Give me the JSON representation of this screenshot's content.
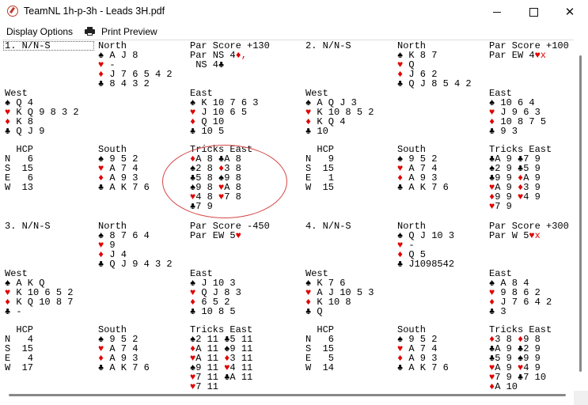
{
  "window": {
    "title": "TeamNL 1h-p-3h - Leads 3H.pdf",
    "minimize_glyph": "—",
    "maximize_glyph": "☐",
    "close_glyph": "✕"
  },
  "menu": {
    "display_options": "Display Options",
    "print_preview": "Print Preview"
  },
  "boards": [
    {
      "header": "1. N/N-S",
      "north": {
        "heading": "North",
        "spades": "A J 8",
        "hearts": "-",
        "diamonds": "J 7 6 5 4 2",
        "clubs": "8 4 3 2"
      },
      "par": [
        "Par Score +130",
        "Par NS 4",
        "♦,",
        " NS 4♣"
      ],
      "west": {
        "heading": "West",
        "spades": "Q 4",
        "hearts": "K Q 9 8 3 2",
        "diamonds": "K 8",
        "clubs": "Q J 9"
      },
      "east": {
        "heading": "East",
        "spades": "K 10 7 6 3",
        "hearts": "J 10 6 5",
        "diamonds": "Q 10",
        "clubs": "10 5"
      },
      "hcp": {
        "heading": "HCP",
        "rows": [
          "N   6",
          "S  15",
          "E   6",
          "W  13"
        ]
      },
      "south": {
        "heading": "South",
        "spades": "9 5 2",
        "hearts": "A 7 4",
        "diamonds": "A 9 3",
        "clubs": "A K 7 6"
      },
      "tricks": {
        "heading": "Tricks East",
        "rows": [
          [
            "♦",
            "A 8 ",
            "♣",
            "A 8"
          ],
          [
            "♠",
            "2 8 ",
            "♦",
            "3 8"
          ],
          [
            "♣",
            "5 8 ",
            "♠",
            "9 8"
          ],
          [
            "♠",
            "9 8 ",
            "♥",
            "A 8"
          ],
          [
            "♥",
            "4 8 ",
            "♥",
            "7 8"
          ],
          [
            "♣",
            "7 9 ",
            "",
            ""
          ]
        ]
      }
    },
    {
      "header": "2. N/N-S",
      "north": {
        "heading": "North",
        "spades": "K 8 7",
        "hearts": "Q",
        "diamonds": "J 6 2",
        "clubs": "Q J 8 5 4 2"
      },
      "par": [
        "Par Score +100",
        "Par EW 4",
        "♥x",
        ""
      ],
      "west": {
        "heading": "West",
        "spades": "A Q J 3",
        "hearts": "K 10 8 5 2",
        "diamonds": "K Q 4",
        "clubs": "10"
      },
      "east": {
        "heading": "East",
        "spades": "10 6 4",
        "hearts": "J 9 6 3",
        "diamonds": "10 8 7 5",
        "clubs": "9 3"
      },
      "hcp": {
        "heading": "HCP",
        "rows": [
          "N   9",
          "S  15",
          "E   1",
          "W  15"
        ]
      },
      "south": {
        "heading": "South",
        "spades": "9 5 2",
        "hearts": "A 7 4",
        "diamonds": "A 9 3",
        "clubs": "A K 7 6"
      },
      "tricks": {
        "heading": "Tricks East",
        "rows": [
          [
            "♣",
            "A 9 ",
            "♣",
            "7 9"
          ],
          [
            "♠",
            "2 9 ",
            "♣",
            "5 9"
          ],
          [
            "♣",
            "9 9 ",
            "♦",
            "A 9"
          ],
          [
            "♥",
            "A 9 ",
            "♦",
            "3 9"
          ],
          [
            "♦",
            "9 9 ",
            "♥",
            "4 9"
          ],
          [
            "♥",
            "7 9 ",
            "",
            ""
          ]
        ]
      }
    },
    {
      "header": "3. N/N-S",
      "north": {
        "heading": "North",
        "spades": "8 7 6 4",
        "hearts": "9",
        "diamonds": "J 4",
        "clubs": "Q J 9 4 3 2"
      },
      "par": [
        "Par Score -450",
        "Par EW 5",
        "♥",
        ""
      ],
      "west": {
        "heading": "West",
        "spades": "A K Q",
        "hearts": "K 10 6 5 2",
        "diamonds": "K Q 10 8 7",
        "clubs": "-"
      },
      "east": {
        "heading": "East",
        "spades": "J 10 3",
        "hearts": "Q J 8 3",
        "diamonds": "6 5 2",
        "clubs": "10 8 5"
      },
      "hcp": {
        "heading": "HCP",
        "rows": [
          "N   4",
          "S  15",
          "E   4",
          "W  17"
        ]
      },
      "south": {
        "heading": "South",
        "spades": "9 5 2",
        "hearts": "A 7 4",
        "diamonds": "A 9 3",
        "clubs": "A K 7 6"
      },
      "tricks": {
        "heading": "Tricks East",
        "rows": [
          [
            "♠",
            "2 11 ",
            "♣",
            "5 11"
          ],
          [
            "♦",
            "A 11 ",
            "♠",
            "9 11"
          ],
          [
            "♥",
            "A 11 ",
            "♦",
            "3 11"
          ],
          [
            "♠",
            "9 11 ",
            "♥",
            "4 11"
          ],
          [
            "♥",
            "7 11 ",
            "♣",
            "A 11"
          ],
          [
            "♥",
            "7 11 ",
            "",
            ""
          ]
        ]
      }
    },
    {
      "header": "4. N/N-S",
      "north": {
        "heading": "North",
        "spades": "Q J 10 3",
        "hearts": "-",
        "diamonds": "Q 5",
        "clubs": "J1098542"
      },
      "par": [
        "Par Score +300",
        "Par W 5",
        "♥x",
        ""
      ],
      "west": {
        "heading": "West",
        "spades": "K 7 6",
        "hearts": "A J 10 5 3",
        "diamonds": "K 10 8",
        "clubs": "Q"
      },
      "east": {
        "heading": "East",
        "spades": "A 8 4",
        "hearts": "9 8 6 2",
        "diamonds": "J 7 6 4 2",
        "clubs": "3"
      },
      "hcp": {
        "heading": "HCP",
        "rows": [
          "N   6",
          "S  15",
          "E   5",
          "W  14"
        ]
      },
      "south": {
        "heading": "South",
        "spades": "9 5 2",
        "hearts": "A 7 4",
        "diamonds": "A 9 3",
        "clubs": "A K 7 6"
      },
      "tricks": {
        "heading": "Tricks East",
        "rows": [
          [
            "♦",
            "3 8 ",
            "♦",
            "9 8"
          ],
          [
            "♣",
            "A 9 ",
            "♣",
            "2 9"
          ],
          [
            "♣",
            "5 9 ",
            "♠",
            "9 9"
          ],
          [
            "♥",
            "A 9 ",
            "♥",
            "4 9"
          ],
          [
            "♥",
            "7 9 ",
            "♣",
            "7 10"
          ],
          [
            "♦",
            "A 10 ",
            "",
            ""
          ]
        ]
      }
    }
  ],
  "colors": {
    "red_suits": "#e00000",
    "annotation": "#d64545"
  }
}
